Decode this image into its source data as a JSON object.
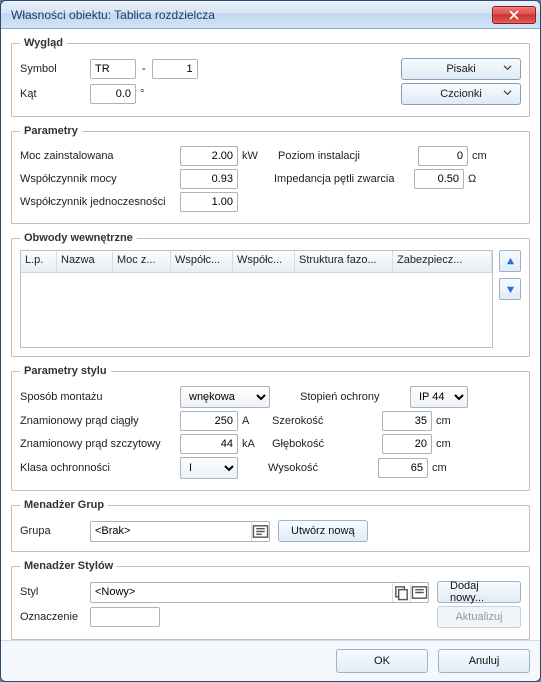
{
  "window": {
    "title": "Własności obiektu: Tablica rozdzielcza"
  },
  "appearance": {
    "legend": "Wygląd",
    "symbol_label": "Symbol",
    "symbol_prefix": "TR",
    "symbol_sep": "-",
    "symbol_num": "1",
    "angle_label": "Kąt",
    "angle_value": "0.0",
    "angle_unit": "°",
    "pens_btn": "Pisaki",
    "fonts_btn": "Czcionki"
  },
  "params": {
    "legend": "Parametry",
    "installed_power_label": "Moc zainstalowana",
    "installed_power_value": "2.00",
    "installed_power_unit": "kW",
    "install_level_label": "Poziom instalacji",
    "install_level_value": "0",
    "install_level_unit": "cm",
    "power_factor_label": "Współczynnik mocy",
    "power_factor_value": "0.93",
    "fault_loop_label": "Impedancja pętli zwarcia",
    "fault_loop_value": "0.50",
    "fault_loop_unit": "Ω",
    "coincidence_label": "Współczynnik jednoczesności",
    "coincidence_value": "1.00"
  },
  "circuits": {
    "legend": "Obwody wewnętrzne",
    "columns": [
      "L.p.",
      "Nazwa",
      "Moc z...",
      "Współc...",
      "Współc...",
      "Struktura fazo...",
      "Zabezpiecz..."
    ]
  },
  "style_params": {
    "legend": "Parametry stylu",
    "mounting_label": "Sposób montażu",
    "mounting_value": "wnękowa",
    "protection_label": "Stopień ochrony",
    "protection_value": "IP 44",
    "rated_current_label": "Znamionowy prąd ciągły",
    "rated_current_value": "250",
    "rated_current_unit": "A",
    "width_label": "Szerokość",
    "width_value": "35",
    "width_unit": "cm",
    "peak_current_label": "Znamionowy prąd szczytowy",
    "peak_current_value": "44",
    "peak_current_unit": "kA",
    "depth_label": "Głębokość",
    "depth_value": "20",
    "depth_unit": "cm",
    "protection_class_label": "Klasa ochronności",
    "protection_class_value": "I",
    "height_label": "Wysokość",
    "height_value": "65",
    "height_unit": "cm"
  },
  "group_mgr": {
    "legend": "Menadżer Grup",
    "group_label": "Grupa",
    "group_value": "<Brak>",
    "create_new": "Utwórz nową"
  },
  "style_mgr": {
    "legend": "Menadżer Stylów",
    "style_label": "Styl",
    "style_value": "<Nowy>",
    "add_new": "Dodaj nowy...",
    "marking_label": "Oznaczenie",
    "marking_value": "",
    "update": "Aktualizuj"
  },
  "footer": {
    "ok": "OK",
    "cancel": "Anuluj"
  }
}
